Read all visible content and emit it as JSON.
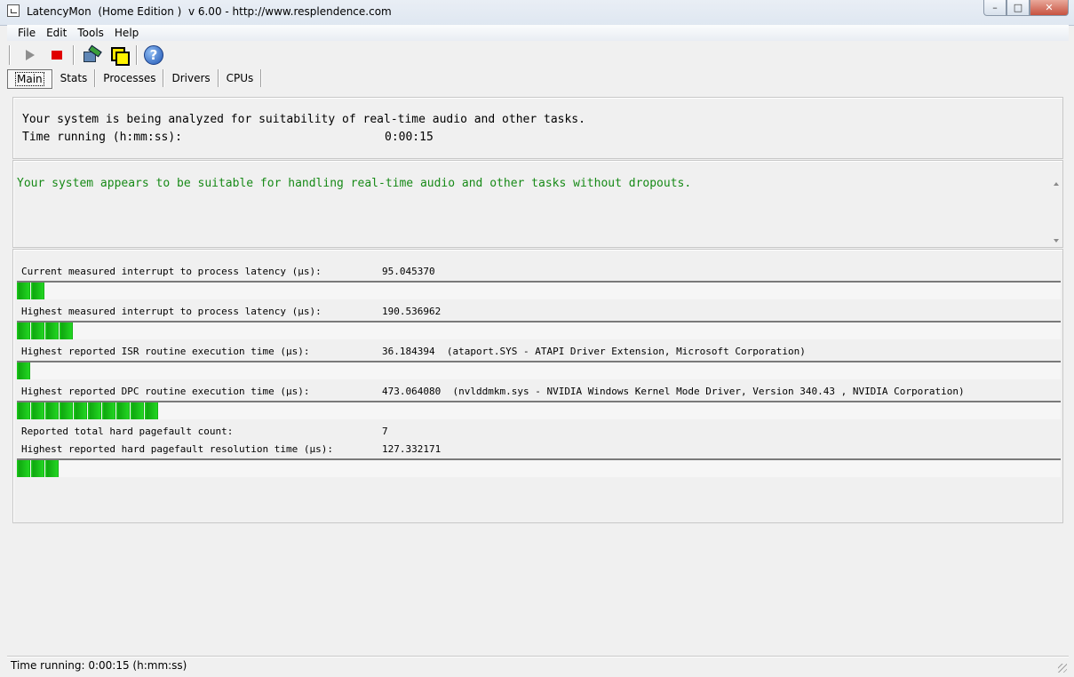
{
  "window": {
    "title": "LatencyMon  (Home Edition )  v 6.00 - http://www.resplendence.com",
    "min": "–",
    "max": "□",
    "close": "✕"
  },
  "menu": [
    "File",
    "Edit",
    "Tools",
    "Help"
  ],
  "tabs": [
    "Main",
    "Stats",
    "Processes",
    "Drivers",
    "CPUs"
  ],
  "toolbar": {
    "help_glyph": "?"
  },
  "status_panel": {
    "line1": "Your system is being analyzed for suitability of real-time audio and other tasks.",
    "time_label": "Time running (h:mm:ss):",
    "time_value": "0:00:15"
  },
  "conclusion": {
    "message": "Your system appears to be suitable for handling real-time audio and other tasks without dropouts.",
    "color": "#178a17"
  },
  "metrics": [
    {
      "label": "Current measured interrupt to process latency (µs):",
      "value": "95.045370",
      "detail": "",
      "bar_blocks": 2
    },
    {
      "label": "Highest measured interrupt to process latency (µs):",
      "value": "190.536962",
      "detail": "",
      "bar_blocks": 4
    },
    {
      "label": "Highest reported ISR routine execution time (µs):",
      "value": "36.184394",
      "detail": "(ataport.SYS - ATAPI Driver Extension, Microsoft Corporation)",
      "bar_blocks": 1
    },
    {
      "label": "Highest reported DPC routine execution time (µs):",
      "value": "473.064080",
      "detail": "(nvlddmkm.sys - NVIDIA Windows Kernel Mode Driver, Version 340.43 , NVIDIA Corporation)",
      "bar_blocks": 10
    },
    {
      "label": "Reported total hard pagefault count:",
      "value": "7",
      "detail": "",
      "bar_blocks": null
    },
    {
      "label": "Highest reported hard pagefault resolution time (µs):",
      "value": "127.332171",
      "detail": "",
      "bar_blocks": 3
    }
  ],
  "statusbar": {
    "text": "Time running: 0:00:15  (h:mm:ss)"
  }
}
